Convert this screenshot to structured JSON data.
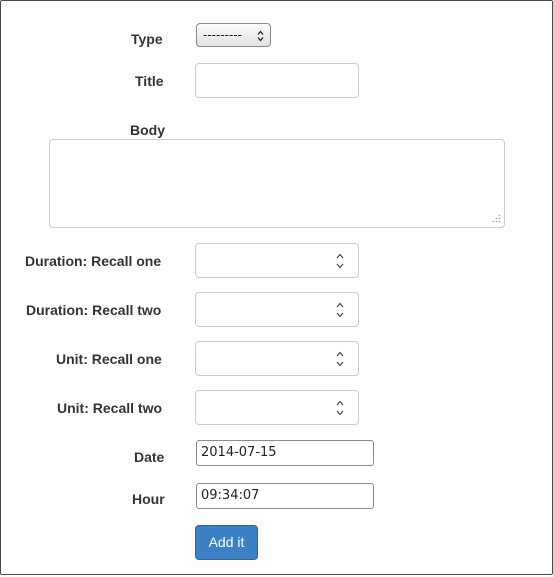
{
  "form": {
    "type": {
      "label": "Type",
      "selected": "---------"
    },
    "title": {
      "label": "Title",
      "value": ""
    },
    "body": {
      "label": "Body",
      "value": ""
    },
    "duration_recall_one": {
      "label": "Duration: Recall one",
      "value": ""
    },
    "duration_recall_two": {
      "label": "Duration: Recall two",
      "value": ""
    },
    "unit_recall_one": {
      "label": "Unit: Recall one",
      "value": ""
    },
    "unit_recall_two": {
      "label": "Unit: Recall two",
      "value": ""
    },
    "date": {
      "label": "Date",
      "value": "2014-07-15"
    },
    "hour": {
      "label": "Hour",
      "value": "09:34:07"
    },
    "submit_label": "Add it"
  }
}
